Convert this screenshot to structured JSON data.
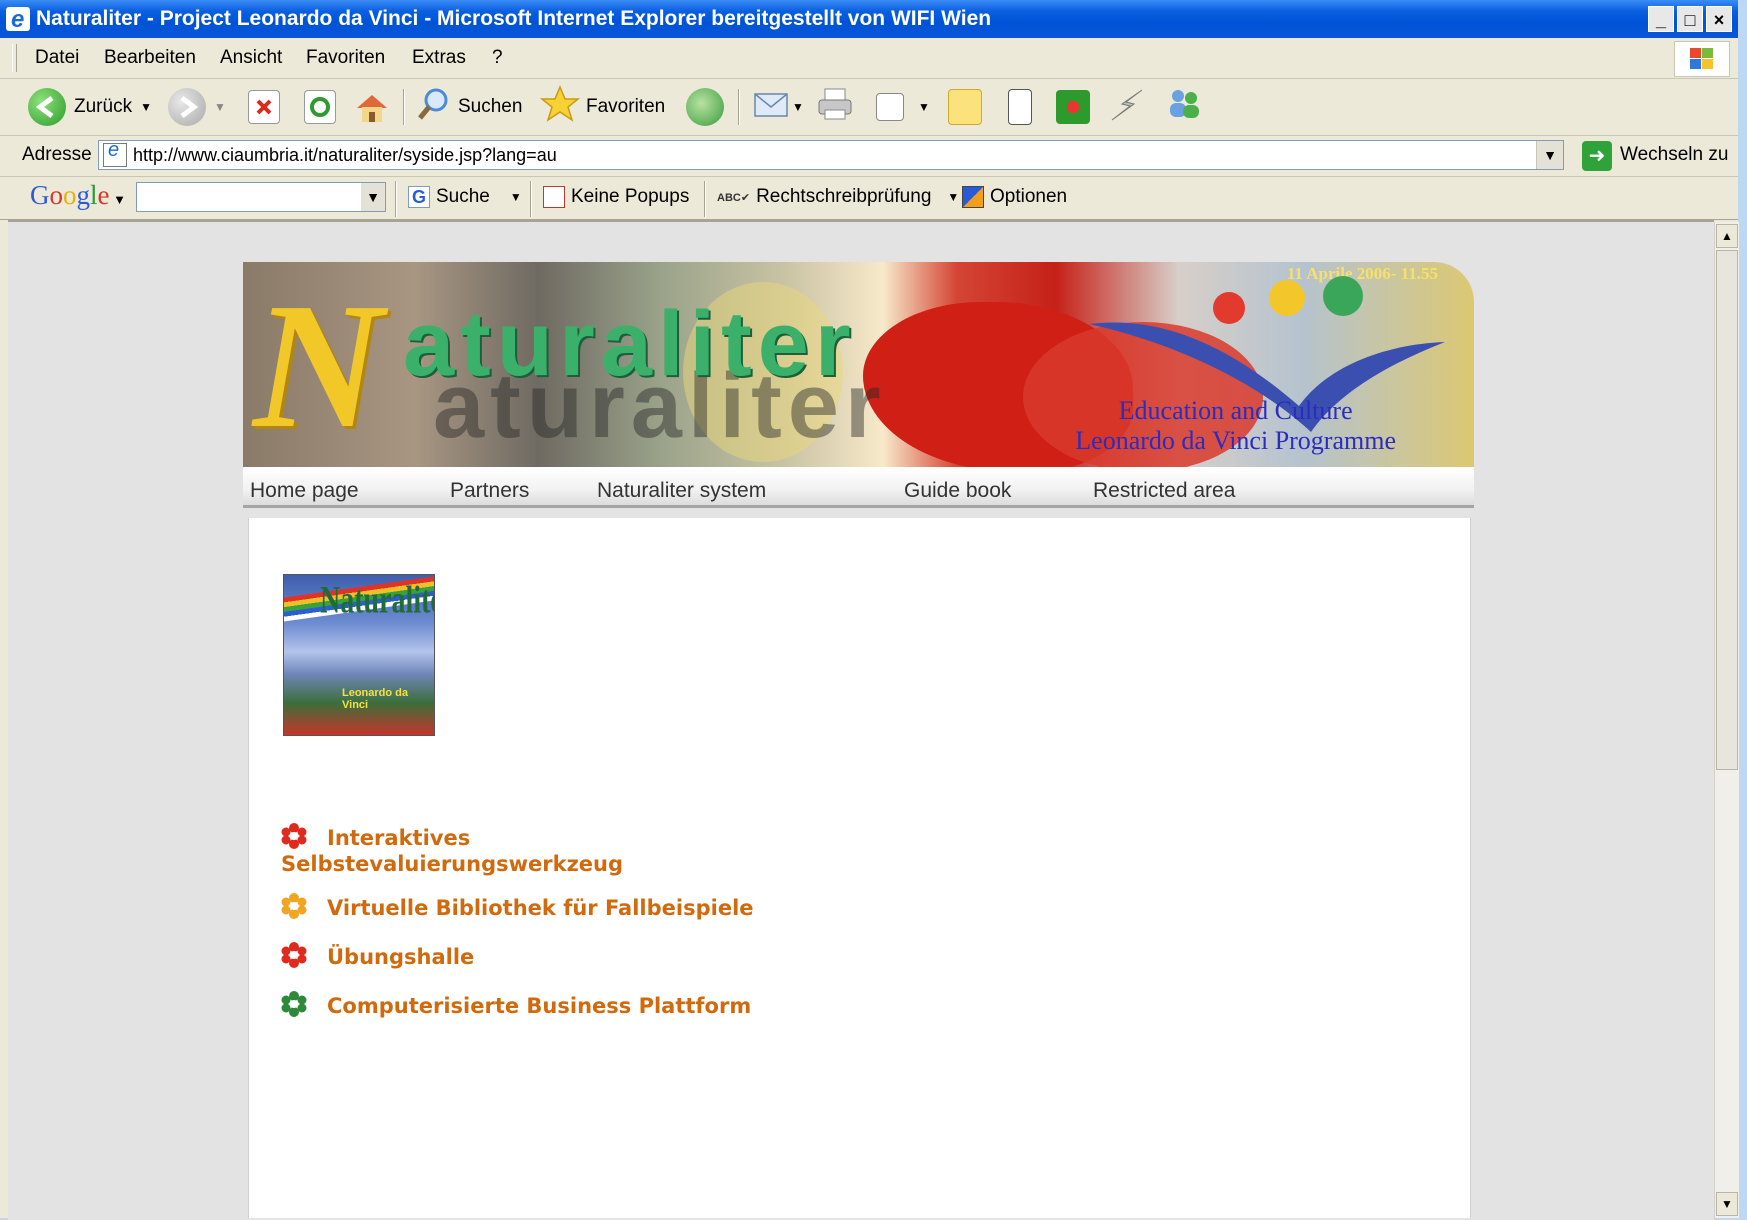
{
  "window": {
    "title": "Naturaliter - Project Leonardo da Vinci - Microsoft Internet Explorer bereitgestellt von WIFI Wien",
    "buttons": [
      "_",
      "□",
      "×"
    ]
  },
  "menu": {
    "items": [
      "Datei",
      "Bearbeiten",
      "Ansicht",
      "Favoriten",
      "Extras",
      "?"
    ]
  },
  "toolbar": {
    "back_label": "Zurück",
    "search_label": "Suchen",
    "favorites_label": "Favoriten"
  },
  "address": {
    "label": "Adresse",
    "url": "http://www.ciaumbria.it/naturaliter/syside.jsp?lang=au",
    "go_label": "Wechseln zu"
  },
  "google_toolbar": {
    "logo": [
      "G",
      "o",
      "o",
      "g",
      "l",
      "e"
    ],
    "search_value": "",
    "search_label": "Suche",
    "popups_label": "Keine Popups",
    "spellcheck_label": "Rechtschreibprüfung",
    "options_label": "Optionen"
  },
  "banner": {
    "logo_letter": "N",
    "logo_word": "aturaliter",
    "datestamp": "11 Aprile 2006- 11.55",
    "program_line1": "Education and Culture",
    "program_line2": "Leonardo da Vinci Programme"
  },
  "nav": {
    "items": [
      "Home page",
      "Partners",
      "Naturaliter system",
      "Guide book",
      "Restricted area"
    ]
  },
  "content": {
    "logo_title": "Naturaliter",
    "logo_subtitle": "Leonardo da Vinci",
    "links": [
      {
        "line1": "Interaktives",
        "line2": "Selbstevaluierungswerkzeug",
        "icon_color": "#e02a1e"
      },
      {
        "line1": "Virtuelle Bibliothek für Fallbeispiele",
        "icon_color": "#f0a623"
      },
      {
        "line1": "Übungshalle",
        "icon_color": "#e02a1e"
      },
      {
        "line1": "Computerisierte Business Plattform",
        "icon_color": "#2e8a3a"
      }
    ],
    "link_color": "#d06a0c"
  },
  "colors": {
    "titlebar": "#0053d6",
    "chrome": "#ece9d8",
    "program_text": "#2b2cc0",
    "logo_green": "#3ab06b",
    "logo_yellow": "#f2c829"
  }
}
